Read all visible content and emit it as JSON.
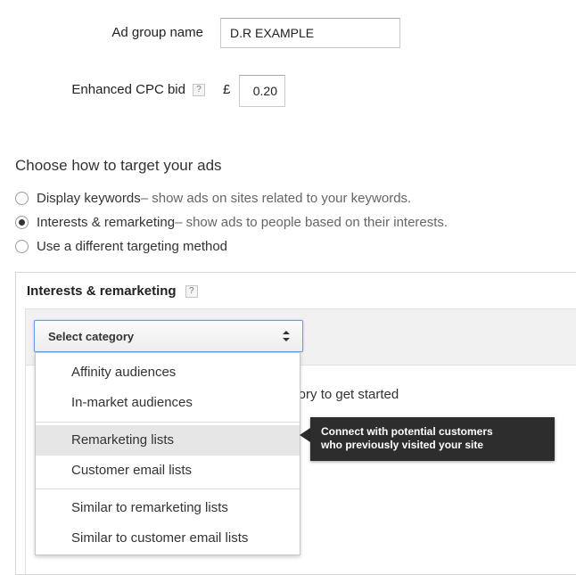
{
  "form": {
    "ad_group_label": "Ad group name",
    "ad_group_value": "D.R EXAMPLE",
    "bid_label": "Enhanced CPC bid",
    "help_glyph": "?",
    "currency": "£",
    "bid_value": "0.20"
  },
  "targeting": {
    "heading": "Choose how to target your ads",
    "options": [
      {
        "label": "Display keywords",
        "desc": " – show ads on sites related to your keywords.",
        "checked": false
      },
      {
        "label": "Interests & remarketing",
        "desc": " – show ads to people based on their interests.",
        "checked": true
      },
      {
        "label": "Use a different targeting method",
        "desc": "",
        "checked": false
      }
    ]
  },
  "panel": {
    "title": "Interests & remarketing",
    "help_glyph": "?",
    "select_label": "Select category",
    "hint_text": "egory to get started"
  },
  "menu": {
    "items": [
      "Affinity audiences",
      "In-market audiences",
      "Remarketing lists",
      "Customer email lists",
      "Similar to remarketing lists",
      "Similar to customer email lists"
    ],
    "highlighted_index": 2
  },
  "tooltip": {
    "line1": "Connect with potential customers",
    "line2": "who previously visited your site"
  },
  "colors": {
    "select_border": "#6d9be3",
    "tooltip_bg": "#2d2d2d",
    "highlight_bg": "#e6e6e6"
  }
}
